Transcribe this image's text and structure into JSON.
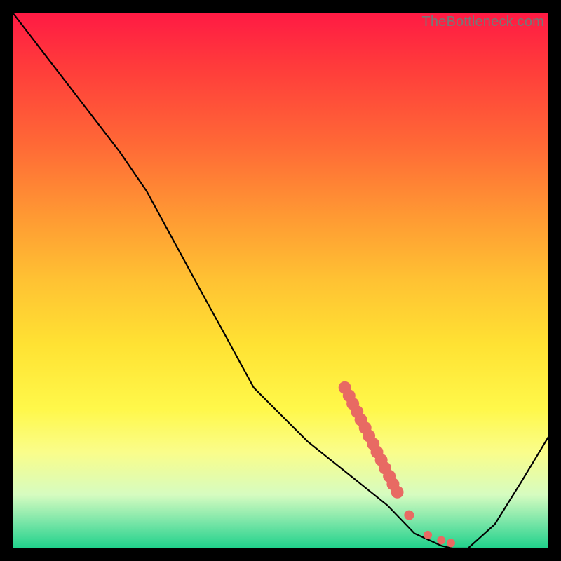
{
  "watermark": "TheBottleneck.com",
  "chart_data": {
    "type": "line",
    "title": "",
    "xlabel": "",
    "ylabel": "",
    "x": [
      0.0,
      0.05,
      0.1,
      0.15,
      0.2,
      0.25,
      0.3,
      0.35,
      0.4,
      0.45,
      0.5,
      0.55,
      0.6,
      0.65,
      0.7,
      0.75,
      0.8,
      0.82,
      0.85,
      0.9,
      0.95,
      1.0
    ],
    "y": [
      1.0,
      0.935,
      0.87,
      0.805,
      0.74,
      0.667,
      0.575,
      0.483,
      0.392,
      0.3,
      0.25,
      0.2,
      0.16,
      0.12,
      0.08,
      0.028,
      0.005,
      0.0,
      0.0,
      0.045,
      0.125,
      0.208
    ],
    "xlim": [
      0,
      1
    ],
    "ylim": [
      0,
      1
    ],
    "points": [
      {
        "x": 0.62,
        "y": 0.3
      },
      {
        "x": 0.628,
        "y": 0.285
      },
      {
        "x": 0.635,
        "y": 0.27
      },
      {
        "x": 0.643,
        "y": 0.255
      },
      {
        "x": 0.65,
        "y": 0.24
      },
      {
        "x": 0.658,
        "y": 0.225
      },
      {
        "x": 0.665,
        "y": 0.21
      },
      {
        "x": 0.673,
        "y": 0.195
      },
      {
        "x": 0.68,
        "y": 0.18
      },
      {
        "x": 0.688,
        "y": 0.165
      },
      {
        "x": 0.695,
        "y": 0.15
      },
      {
        "x": 0.703,
        "y": 0.135
      },
      {
        "x": 0.71,
        "y": 0.12
      },
      {
        "x": 0.718,
        "y": 0.105
      },
      {
        "x": 0.74,
        "y": 0.062
      },
      {
        "x": 0.775,
        "y": 0.025
      },
      {
        "x": 0.8,
        "y": 0.015
      },
      {
        "x": 0.818,
        "y": 0.01
      }
    ],
    "points_color": "#e86a63",
    "line_color": "#000000",
    "gradient_stops": [
      {
        "pos": 0.0,
        "color": "#ff1a44"
      },
      {
        "pos": 0.5,
        "color": "#ffe233"
      },
      {
        "pos": 1.0,
        "color": "#1fd18b"
      }
    ]
  }
}
